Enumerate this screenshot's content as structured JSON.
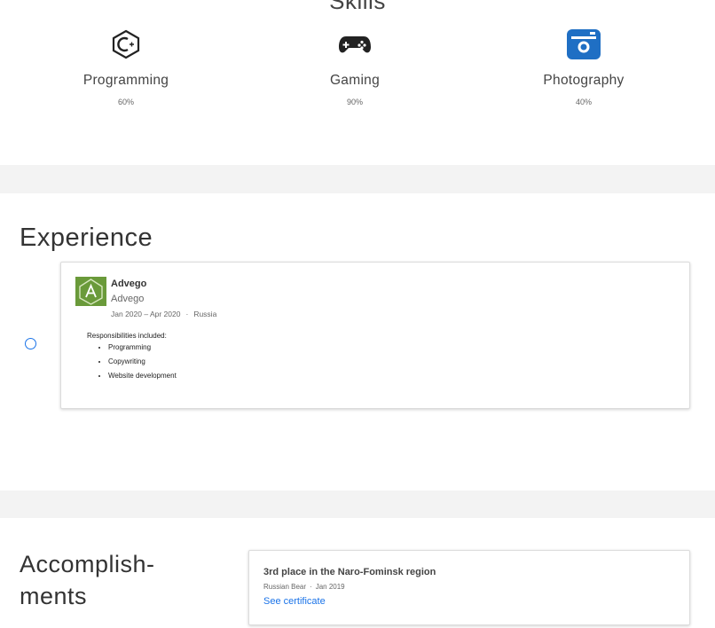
{
  "skills": {
    "title": "Skills",
    "items": [
      {
        "name": "Programming",
        "percent": "60%",
        "icon": "c-plus-plus-icon"
      },
      {
        "name": "Gaming",
        "percent": "90%",
        "icon": "gamepad-icon"
      },
      {
        "name": "Photography",
        "percent": "40%",
        "icon": "camera-icon"
      }
    ]
  },
  "experience": {
    "title": "Experience",
    "job": {
      "company": "Advego",
      "company_sub": "Advego",
      "dates": "Jan 2020 – Apr 2020",
      "separator": "·",
      "location": "Russia",
      "responsibilities_label": "Responsibilities included:",
      "responsibilities": [
        "Programming",
        "Copywriting",
        "Website development"
      ]
    }
  },
  "accomplishments": {
    "title_line1": "Accomplish-",
    "title_line2": "ments",
    "item": {
      "title": "3rd place in the Naro-Fominsk region",
      "issuer": "Russian Bear",
      "separator": "·",
      "date": "Jan 2019",
      "link_label": "See certificate"
    }
  },
  "colors": {
    "accent": "#1a73e8",
    "icon_blue": "#1f6fc4",
    "logo_green": "#6a9a3a",
    "band_gray": "#f3f3f3"
  }
}
